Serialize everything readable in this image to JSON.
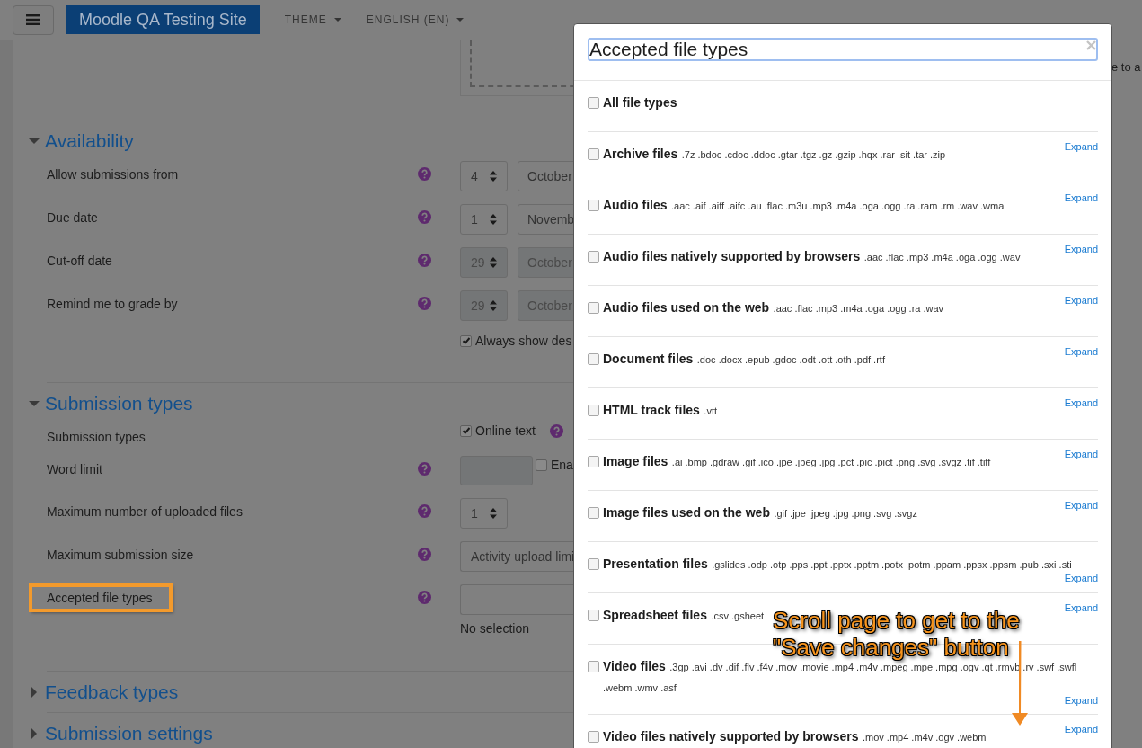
{
  "navbar": {
    "site_name": "Moodle QA Testing Site",
    "menus": [
      "THEME",
      "ENGLISH (EN)"
    ]
  },
  "page": {
    "file_drop_text": "e to a",
    "sections": [
      {
        "title": "Availability",
        "expanded": true,
        "fields": [
          {
            "kind": "date",
            "label": "Allow submissions from",
            "day": "4",
            "month": "October",
            "disabled": false
          },
          {
            "kind": "date",
            "label": "Due date",
            "day": "1",
            "month": "Novemb",
            "disabled": false
          },
          {
            "kind": "date",
            "label": "Cut-off date",
            "day": "29",
            "month": "October",
            "disabled": true
          },
          {
            "kind": "date",
            "label": "Remind me to grade by",
            "day": "29",
            "month": "October",
            "disabled": true
          },
          {
            "kind": "checkbox",
            "text": "Always show des",
            "checked": true
          }
        ]
      },
      {
        "title": "Submission types",
        "expanded": true,
        "fields": [
          {
            "kind": "options",
            "label": "Submission types",
            "options": [
              {
                "text": "Online text",
                "checked": true
              }
            ]
          },
          {
            "kind": "limit",
            "label": "Word limit",
            "disabled": true,
            "text": "Ena",
            "checked": false
          },
          {
            "kind": "select",
            "label": "Maximum number of uploaded files",
            "value": "1"
          },
          {
            "kind": "select_wide",
            "label": "Maximum submission size",
            "value": "Activity upload limi"
          },
          {
            "kind": "filetypes",
            "label": "Accepted file types",
            "highlighted": true,
            "note": "No selection"
          }
        ]
      },
      {
        "title": "Feedback types",
        "expanded": false
      },
      {
        "title": "Submission settings",
        "expanded": false
      }
    ]
  },
  "modal": {
    "title": "Accepted file types",
    "rows": [
      {
        "name": "All file types",
        "extensions": "",
        "checked": false
      },
      {
        "name": "Archive files",
        "extensions": ".7z .bdoc .cdoc .ddoc .gtar .tgz .gz .gzip .hqx .rar .sit .tar .zip",
        "checked": false,
        "action": "Expand"
      },
      {
        "name": "Audio files",
        "extensions": ".aac .aif .aiff .aifc .au .flac .m3u .mp3 .m4a .oga .ogg .ra .ram .rm .wav .wma",
        "checked": false,
        "action": "Expand"
      },
      {
        "name": "Audio files natively supported by browsers",
        "extensions": ".aac .flac .mp3 .m4a .oga .ogg .wav",
        "checked": false,
        "action": "Expand"
      },
      {
        "name": "Audio files used on the web",
        "extensions": ".aac .flac .mp3 .m4a .oga .ogg .ra .wav",
        "checked": false,
        "action": "Expand"
      },
      {
        "name": "Document files",
        "extensions": ".doc .docx .epub .gdoc .odt .ott .oth .pdf .rtf",
        "checked": false,
        "action": "Expand"
      },
      {
        "name": "HTML track files",
        "extensions": ".vtt",
        "checked": false,
        "action": "Expand"
      },
      {
        "name": "Image files",
        "extensions": ".ai .bmp .gdraw .gif .ico .jpe .jpeg .jpg .pct .pic .pict .png .svg .svgz .tif .tiff",
        "checked": false,
        "action": "Expand"
      },
      {
        "name": "Image files used on the web",
        "extensions": ".gif .jpe .jpeg .jpg .png .svg .svgz",
        "checked": false,
        "action": "Expand"
      },
      {
        "name": "Presentation files",
        "extensions": ".gslides .odp .otp .pps .ppt .pptx .pptm .potx .potm .ppam .ppsx .ppsm .pub .sxi .sti",
        "checked": false,
        "action": "Expand"
      },
      {
        "name": "Spreadsheet files",
        "extensions": ".csv .gsheet",
        "checked": false,
        "action": "Expand"
      },
      {
        "name": "Video files",
        "extensions": ".3gp .avi .dv .dif .flv .f4v .mov .movie .mp4 .m4v .mpeg .mpe .mpg .ogv .qt .rmvb .rv .swf .swfl .webm .wmv .asf",
        "checked": false,
        "action": "Expand"
      },
      {
        "name": "Video files natively supported by browsers",
        "extensions": ".mov .mp4 .m4v .ogv .webm",
        "checked": false,
        "action": "Expand"
      }
    ]
  },
  "annotation": {
    "lines": [
      "Scroll page to get to the",
      "\"Save changes\" button"
    ]
  }
}
